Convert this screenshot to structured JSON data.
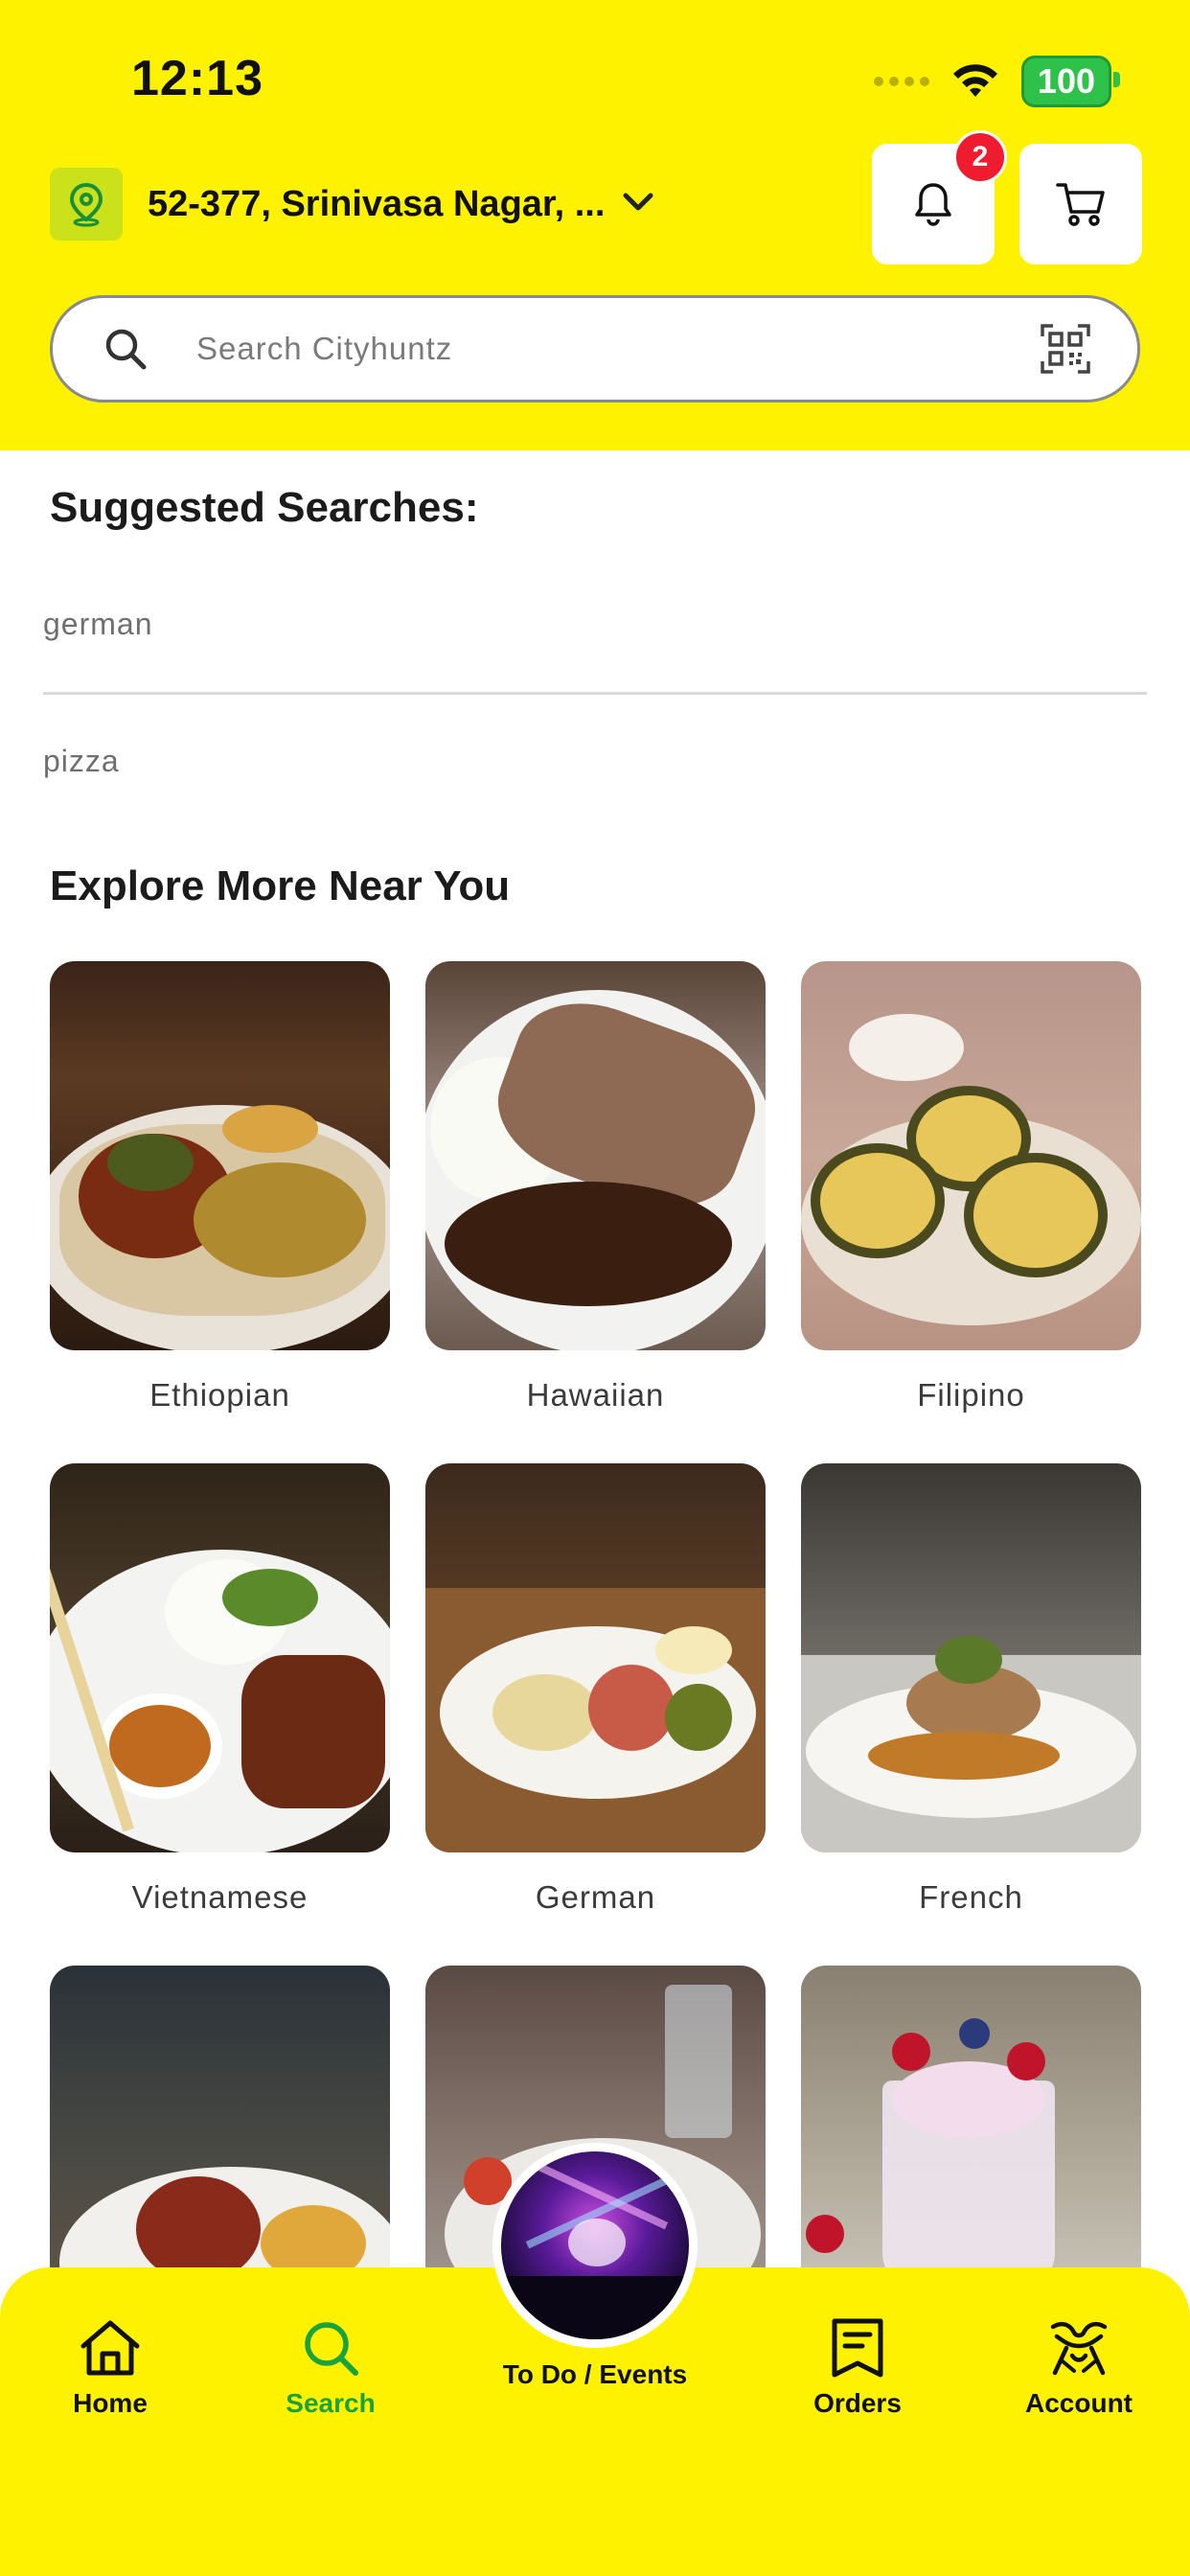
{
  "status_bar": {
    "time": "12:13",
    "battery": "100"
  },
  "header": {
    "location": "52-377, Srinivasa Nagar, ...",
    "notification_count": "2",
    "search_placeholder": "Search Cityhuntz"
  },
  "suggested": {
    "title": "Suggested Searches:",
    "items": [
      "german",
      "pizza"
    ]
  },
  "explore": {
    "title": "Explore More Near You",
    "items": [
      {
        "label": "Ethiopian"
      },
      {
        "label": "Hawaiian"
      },
      {
        "label": "Filipino"
      },
      {
        "label": "Vietnamese"
      },
      {
        "label": "German"
      },
      {
        "label": "French"
      },
      {
        "label": ""
      },
      {
        "label": ""
      },
      {
        "label": ""
      }
    ]
  },
  "bottom_nav": {
    "home": "Home",
    "search": "Search",
    "events": "To Do / Events",
    "orders": "Orders",
    "account": "Account"
  },
  "colors": {
    "brand_yellow": "#fff200",
    "active_green": "#1aa33a",
    "badge_red": "#ee1c2e"
  }
}
